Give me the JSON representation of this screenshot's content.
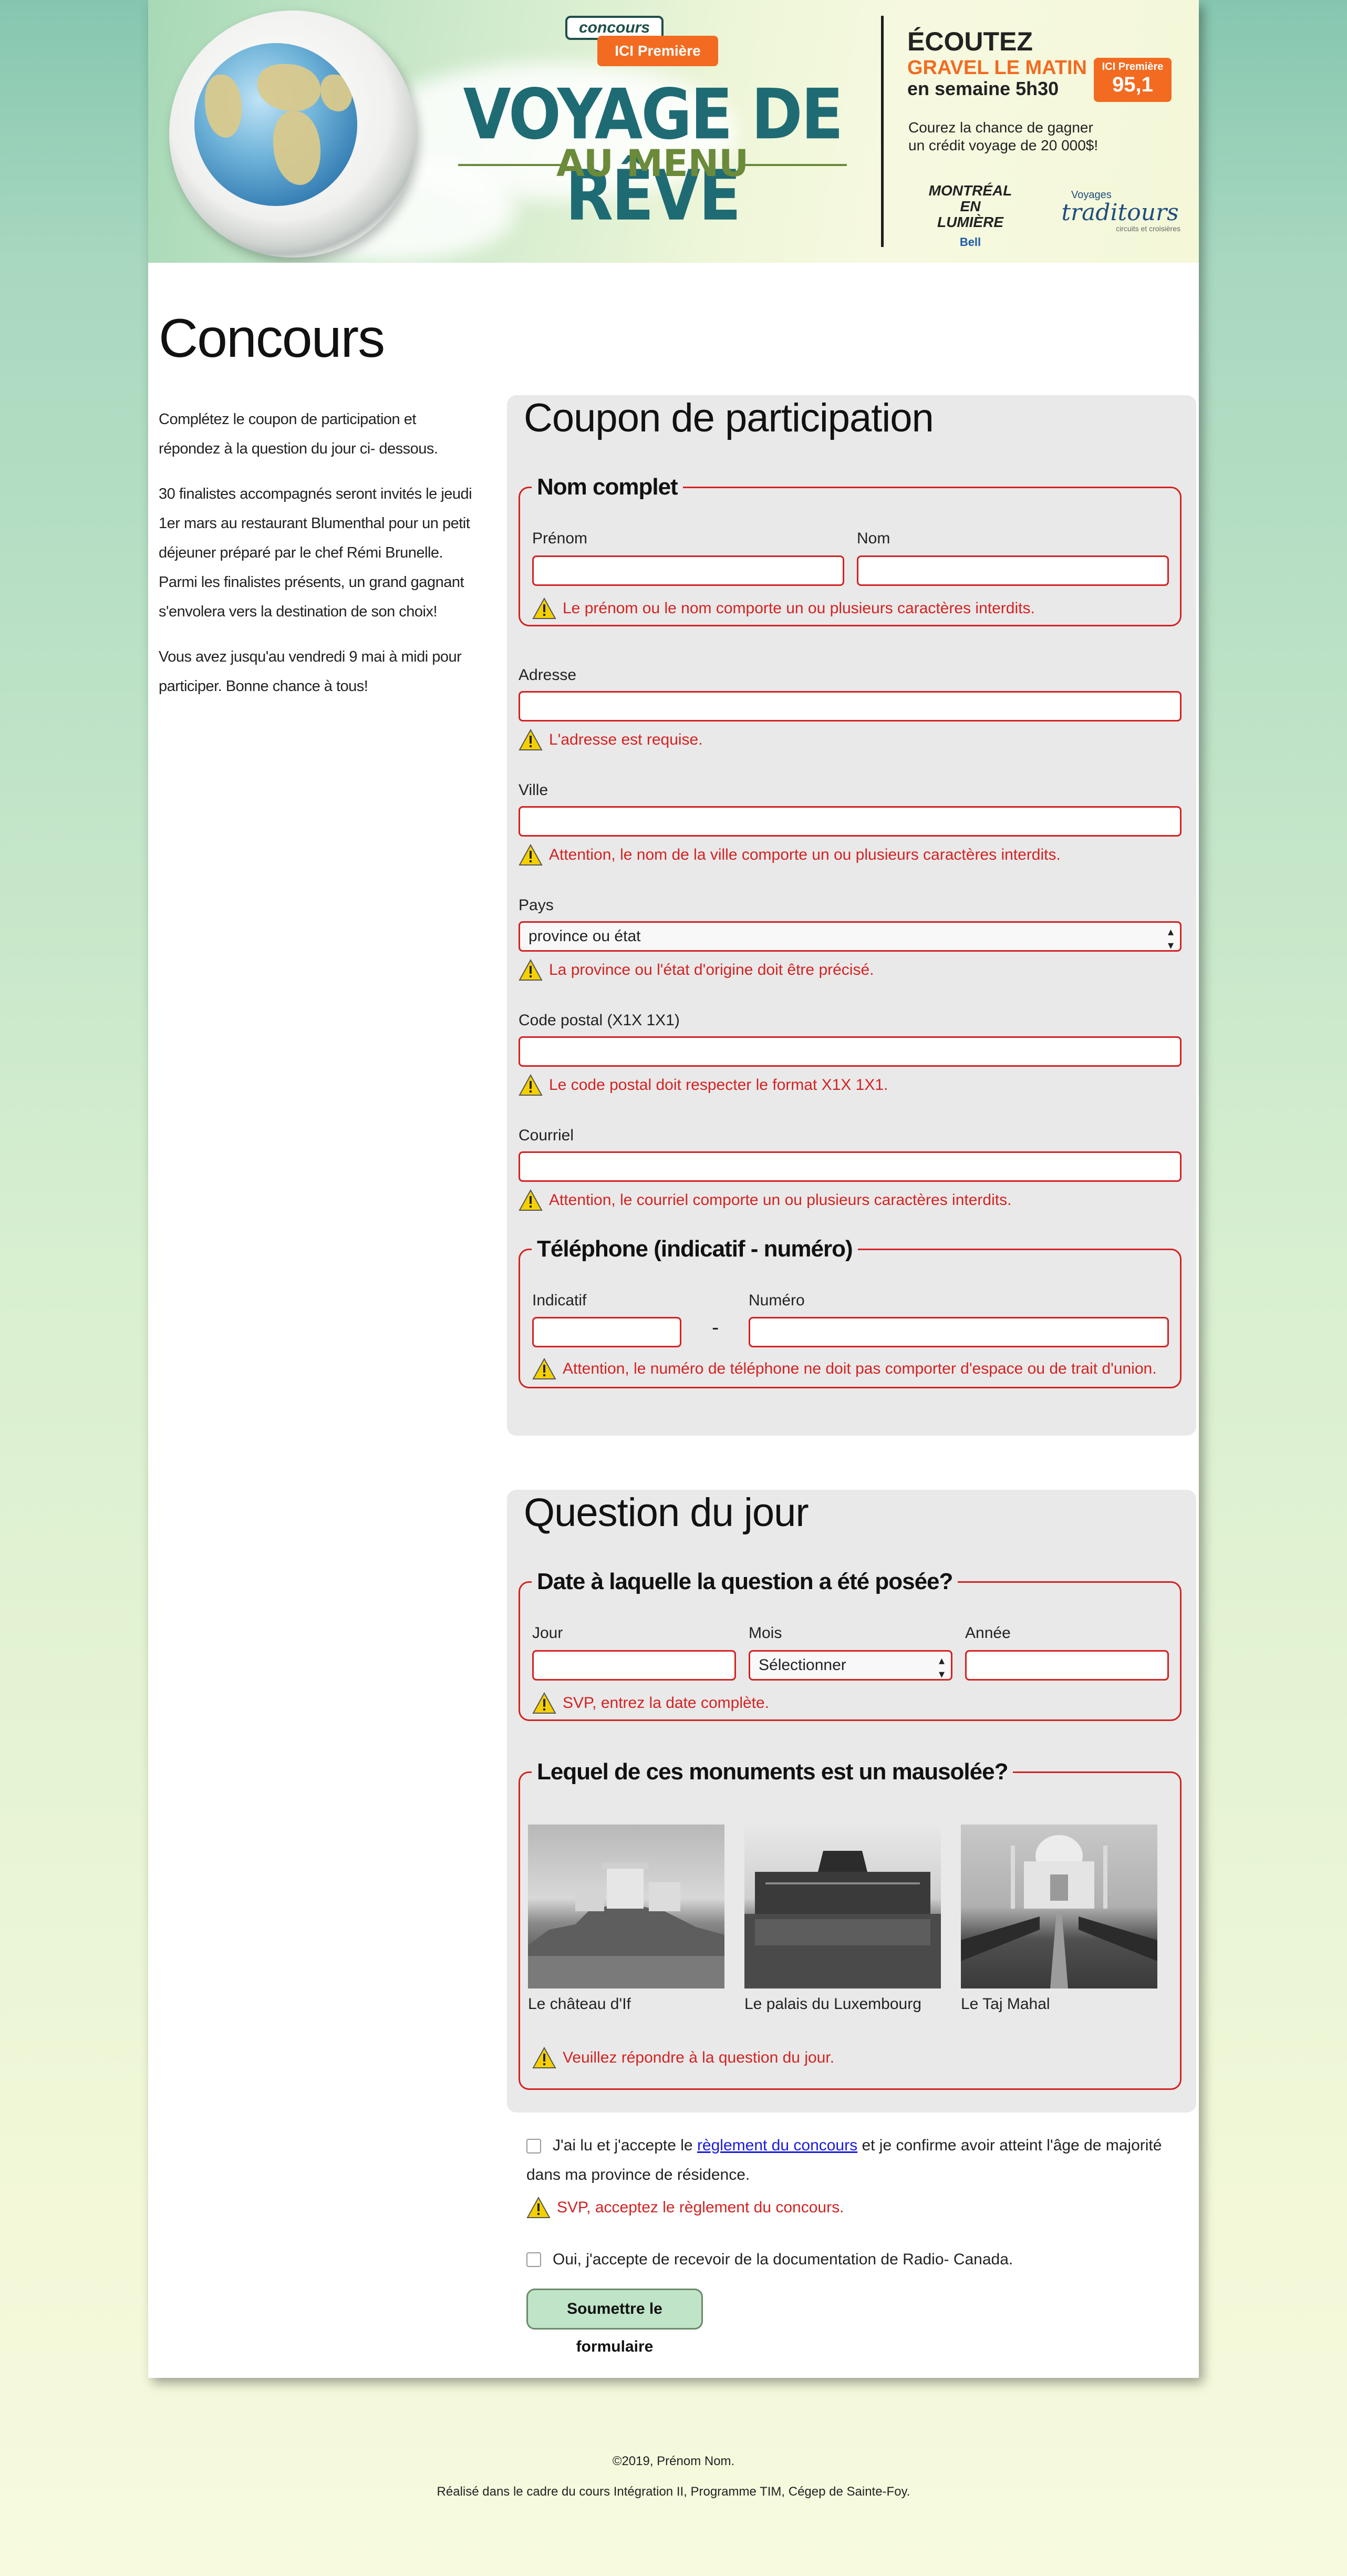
{
  "banner": {
    "concours_tag": "concours",
    "ici_premiere": "ICI Première",
    "title_line1": "VOYAGE DE RÊVE",
    "title_line2": "AU MENU",
    "ecoutez": "ÉCOUTEZ",
    "show_name": "GRAVEL LE MATIN",
    "schedule": "en semaine 5h30",
    "radio_badge_top": "ICI Première",
    "radio_badge_freq": "95,1",
    "tagline_line1": "Courez la chance de gagner",
    "tagline_line2": "un crédit voyage de 20 000$!",
    "sponsor1_line1": "MONTRÉAL",
    "sponsor1_line2": "EN LUMIÈRE",
    "sponsor1_sub": "Bell",
    "sponsor2_small": "Voyages",
    "sponsor2_name": "traditours",
    "sponsor2_sub": "circuits et croisières"
  },
  "page": {
    "title": "Concours",
    "intro": [
      "Complétez le coupon de participation et répondez à la question du jour ci- dessous.",
      "30 finalistes accompagnés seront invités le jeudi 1er mars au restaurant Blumenthal pour un petit déjeuner préparé par le chef Rémi Brunelle. Parmi les finalistes présents, un grand gagnant s'envolera vers la destination de son choix!",
      "Vous avez jusqu'au vendredi 9 mai à midi pour participer. Bonne chance à tous!"
    ]
  },
  "coupon": {
    "title": "Coupon de participation",
    "name_legend": "Nom complet",
    "prenom_label": "Prénom",
    "nom_label": "Nom",
    "name_error": "Le prénom ou le nom comporte un ou plusieurs caractères interdits.",
    "adresse_label": "Adresse",
    "adresse_error": "L'adresse est requise.",
    "ville_label": "Ville",
    "ville_error": "Attention, le nom de la ville comporte un ou plusieurs caractères interdits.",
    "pays_label": "Pays",
    "pays_value": "province ou état",
    "pays_error": "La province ou l'état d'origine doit être précisé.",
    "postal_label": "Code postal (X1X 1X1)",
    "postal_error": "Le code postal doit respecter le format X1X 1X1.",
    "courriel_label": "Courriel",
    "courriel_error": "Attention, le courriel comporte un ou plusieurs caractères interdits.",
    "tel_legend": "Téléphone (indicatif - numéro)",
    "indicatif_label": "Indicatif",
    "numero_label": "Numéro",
    "tel_separator": "-",
    "tel_error": "Attention, le numéro de téléphone ne doit pas comporter d'espace ou de trait d'union."
  },
  "question": {
    "title": "Question du jour",
    "date_legend": "Date à laquelle la question a été posée?",
    "jour_label": "Jour",
    "mois_label": "Mois",
    "mois_value": "Sélectionner",
    "annee_label": "Année",
    "date_error": "SVP, entrez la date complète.",
    "monument_legend": "Lequel de ces monuments est un mausolée?",
    "options": [
      {
        "caption": "Le château d'If"
      },
      {
        "caption": "Le palais du Luxembourg"
      },
      {
        "caption": "Le Taj Mahal"
      }
    ],
    "monument_error": "Veuillez répondre à la question du jour."
  },
  "consent": {
    "rules_before": "J'ai lu et j'accepte le ",
    "rules_link": "règlement du concours",
    "rules_after": " et je confirme avoir atteint l'âge de majorité dans ma province de résidence.",
    "rules_error": "SVP, acceptez le règlement du concours.",
    "newsletter": "Oui, j'accepte de recevoir de la documentation de Radio- Canada.",
    "submit": "Soumettre le formulaire"
  },
  "footer": {
    "line1": "©2019, Prénom Nom.",
    "line2": "Réalisé dans le cadre du cours Intégration II, Programme TIM, Cégep de Sainte-Foy."
  }
}
